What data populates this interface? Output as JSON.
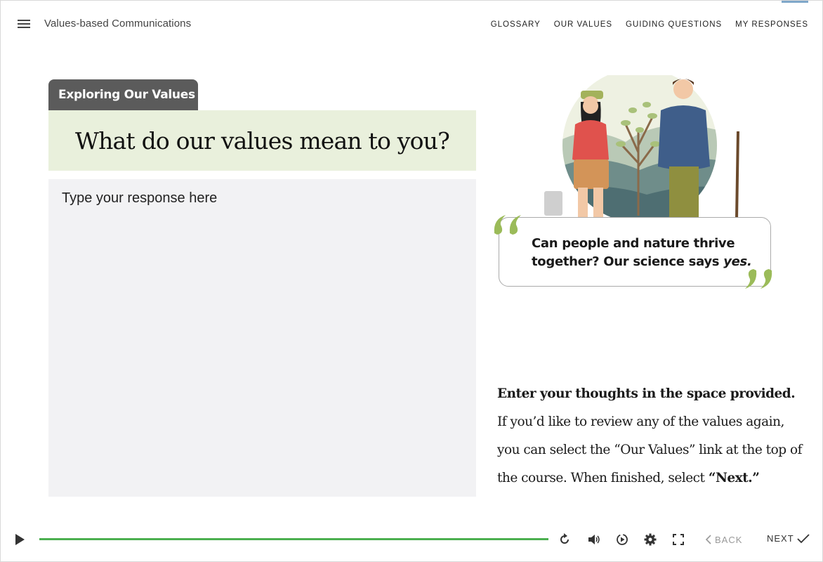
{
  "header": {
    "menu_icon": "hamburger-icon",
    "course_title": "Values-based Communications",
    "nav": [
      "GLOSSARY",
      "OUR VALUES",
      "GUIDING QUESTIONS",
      "MY RESPONSES"
    ]
  },
  "main": {
    "section_tab": "Exploring Our Values",
    "question": "What do our values mean to you?",
    "response_placeholder": "Type your response here",
    "quote_line1": "Can people and nature thrive",
    "quote_line2_prefix": "together? Our science says ",
    "quote_line2_emph": "yes.",
    "instructions_bold": "Enter your thoughts in the space provided.",
    "instructions_body": " If you’d like to review any of the values again, you can select the “Our Values” link at the top of the course. When finished, select ",
    "instructions_next": "“Next.”"
  },
  "player": {
    "progress_fraction": 1.0,
    "back_label": "BACK",
    "next_label": "NEXT",
    "icons": [
      "play-icon",
      "replay-icon",
      "volume-icon",
      "speed-icon",
      "settings-icon",
      "fullscreen-icon"
    ]
  },
  "colors": {
    "tab_bg": "#5b5b5b",
    "question_bg": "#e9f0dc",
    "response_bg": "#f2f2f4",
    "progress": "#4caf50",
    "quote_mark": "#9bbb59"
  }
}
